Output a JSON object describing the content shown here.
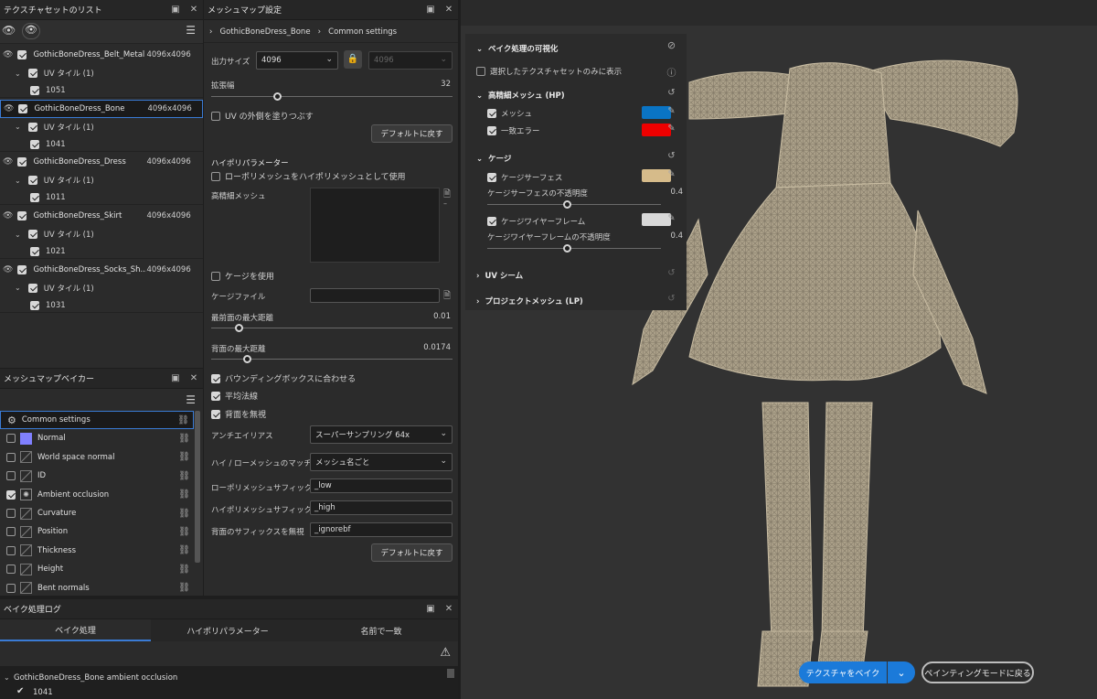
{
  "texture_sets": {
    "title": "テクスチャセットのリスト",
    "items": [
      {
        "name": "GothicBoneDress_Belt_Metal",
        "size": "4096x4096",
        "uv_label": "UV タイル (1)",
        "tile": "1051",
        "selected": false
      },
      {
        "name": "GothicBoneDress_Bone",
        "size": "4096x4096",
        "uv_label": "UV タイル (1)",
        "tile": "1041",
        "selected": true
      },
      {
        "name": "GothicBoneDress_Dress",
        "size": "4096x4096",
        "uv_label": "UV タイル (1)",
        "tile": "1011",
        "selected": false
      },
      {
        "name": "GothicBoneDress_Skirt",
        "size": "4096x4096",
        "uv_label": "UV タイル (1)",
        "tile": "1021",
        "selected": false
      },
      {
        "name": "GothicBoneDress_Socks_Sh...",
        "size": "4096x4096",
        "uv_label": "UV タイル (1)",
        "tile": "1031",
        "selected": false
      }
    ]
  },
  "baker": {
    "title": "メッシュマップベイカー",
    "items": [
      {
        "label": "Common settings",
        "checked": null,
        "icon": "gear-icon"
      },
      {
        "label": "Normal",
        "checked": false,
        "icon": "normal-swatch"
      },
      {
        "label": "World space normal",
        "checked": false,
        "icon": "map-icon"
      },
      {
        "label": "ID",
        "checked": false,
        "icon": "map-icon"
      },
      {
        "label": "Ambient occlusion",
        "checked": true,
        "icon": "ao-icon"
      },
      {
        "label": "Curvature",
        "checked": false,
        "icon": "map-icon"
      },
      {
        "label": "Position",
        "checked": false,
        "icon": "map-icon"
      },
      {
        "label": "Thickness",
        "checked": false,
        "icon": "map-icon"
      },
      {
        "label": "Height",
        "checked": false,
        "icon": "map-icon"
      },
      {
        "label": "Bent normals",
        "checked": false,
        "icon": "map-icon"
      }
    ]
  },
  "settings": {
    "title": "メッシュマップ設定",
    "breadcrumb": [
      "GothicBoneDress_Bone",
      "Common settings"
    ],
    "output_size_label": "出力サイズ",
    "output_size": "4096",
    "output_size2": "4096",
    "dilation_label": "拡張幅",
    "dilation_value": "32",
    "fill_outside_uv": "UV の外側を塗りつぶす",
    "reset1": "デフォルトに戻す",
    "hipoly_section": "ハイポリパラメーター",
    "use_lowpoly": "ローポリメッシュをハイポリメッシュとして使用",
    "hipoly_mesh_label": "高精細メッシュ",
    "use_cage": "ケージを使用",
    "cage_file_label": "ケージファイル",
    "max_frontal_label": "最前面の最大距離",
    "max_frontal_value": "0.01",
    "max_rear_label": "背面の最大距離",
    "max_rear_value": "0.0174",
    "match_bbox": "バウンディングボックスに合わせる",
    "average_normals": "平均法線",
    "ignore_backface": "背面を無視",
    "antialias_label": "アンチエイリアス",
    "antialias_value": "スーパーサンプリング 64x",
    "matching_label": "ハイ / ローメッシュのマッチング",
    "matching_value": "メッシュ名ごと",
    "low_suffix_label": "ローポリメッシュサフィックス",
    "low_suffix": "_low",
    "high_suffix_label": "ハイポリメッシュサフィックス",
    "high_suffix": "_high",
    "ignore_suffix_label": "背面のサフィックスを無視",
    "ignore_suffix": "_ignorebf",
    "reset2": "デフォルトに戻す"
  },
  "log": {
    "title": "ベイク処理ログ",
    "tabs": [
      "ベイク処理",
      "ハイポリパラメーター",
      "名前で一致"
    ],
    "entry": "GothicBoneDress_Bone ambient occlusion",
    "entry_sub": "1041"
  },
  "viz": {
    "title": "ベイク処理の可視化",
    "show_selected": "選択したテクスチャセットのみに表示",
    "hp_section": "高精細メッシュ (HP)",
    "mesh": "メッシュ",
    "match_error": "一致エラー",
    "cage_section": "ケージ",
    "cage_surface": "ケージサーフェス",
    "cage_surface_opacity_label": "ケージサーフェスの不透明度",
    "cage_surface_opacity": "0.4",
    "cage_wire": "ケージワイヤーフレーム",
    "cage_wire_opacity_label": "ケージワイヤーフレームの不透明度",
    "cage_wire_opacity": "0.4",
    "uv_seam": "UV シーム",
    "project_mesh": "プロジェクトメッシュ (LP)",
    "colors": {
      "mesh": "#0a74c4",
      "match_error": "#ee0000",
      "cage_surface": "#d6bb8a",
      "cage_wire": "#d8d8d8"
    }
  },
  "viewport": {
    "bake_button": "テクスチャをベイク",
    "back_button": "ペインティングモードに戻る"
  }
}
